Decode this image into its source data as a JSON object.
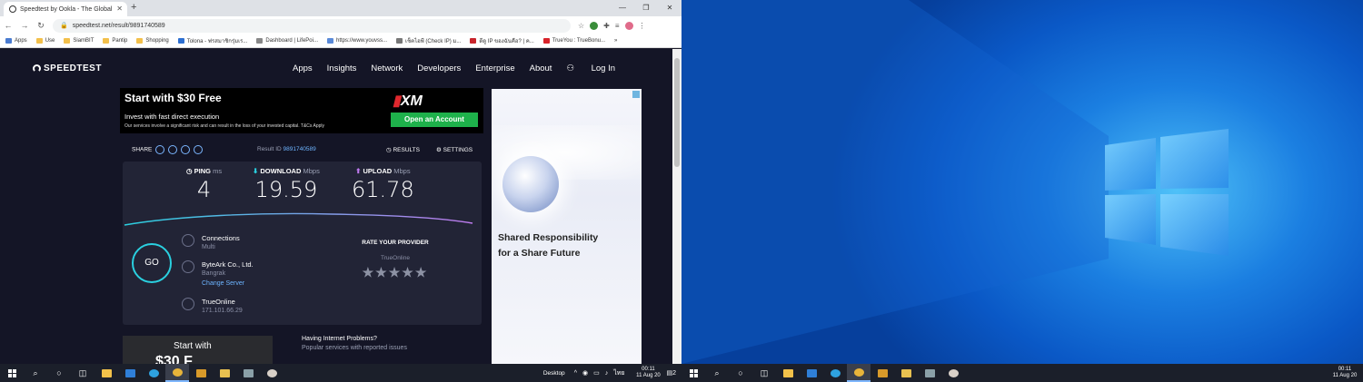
{
  "browser": {
    "tab_title": "Speedtest by Ookla - The Global",
    "tab_close": "✕",
    "new_tab": "+",
    "win_min": "—",
    "win_restore": "❐",
    "win_close": "✕",
    "url": "speedtest.net/result/9891740589",
    "bookmarks": [
      {
        "label": "Apps"
      },
      {
        "label": "Use"
      },
      {
        "label": "SiamBIT"
      },
      {
        "label": "Pantip"
      },
      {
        "label": "Shopping"
      },
      {
        "label": "Tolona - ฟรสมาชิกรุ่มเร..."
      },
      {
        "label": "Dashboard | LifePoi..."
      },
      {
        "label": "https://www.youvss..."
      },
      {
        "label": "เช็คไอพี (Check IP) ม..."
      },
      {
        "label": "ดีดู IP ของฉันคือ? | ค..."
      },
      {
        "label": "TrueYou : TrueBonu..."
      }
    ],
    "more": "»"
  },
  "site": {
    "logo": "SPEEDTEST",
    "nav": [
      "Apps",
      "Insights",
      "Network",
      "Developers",
      "Enterprise",
      "About"
    ],
    "login": "Log In"
  },
  "ad_top": {
    "headline": "Start with $30 Free",
    "sub": "Invest with fast direct execution",
    "fine": "Our services involve a significant risk and can result in the loss of your invested capital. T&Cs Apply",
    "brand": "XM",
    "cta": "Open an Account"
  },
  "share": {
    "label": "SHARE",
    "result_label": "Result ID",
    "result_id": "9891740589",
    "results_btn": "RESULTS",
    "settings_btn": "SETTINGS"
  },
  "metrics": {
    "ping": {
      "label": "PING",
      "unit": "ms",
      "value": "4"
    },
    "download": {
      "label": "DOWNLOAD",
      "unit": "Mbps",
      "value": "19.59"
    },
    "upload": {
      "label": "UPLOAD",
      "unit": "Mbps",
      "value": "61.78"
    }
  },
  "server": {
    "go": "GO",
    "connections_label": "Connections",
    "connections_value": "Multi",
    "host": "ByteArk Co., Ltd.",
    "location": "Bangrak",
    "change": "Change Server",
    "isp": "TrueOnline",
    "ip": "171.101.66.29"
  },
  "rate": {
    "title": "RATE YOUR PROVIDER",
    "isp": "TrueOnline",
    "stars": "★★★★★"
  },
  "ad_bottom": {
    "headline": "Start with",
    "big": "$30 F"
  },
  "help": {
    "title": "Having Internet Problems?",
    "sub": "Popular services with reported issues"
  },
  "ad_side": {
    "line1": "Shared Responsibility",
    "line2": "for a Share Future"
  },
  "taskbar_left": {
    "desktop": "Desktop",
    "lang": "ไทย",
    "time": "00:11",
    "date": "11 Aug 20",
    "notif": "2"
  },
  "taskbar_right": {
    "time": "00:11",
    "date": "11 Aug 20"
  },
  "icons": {
    "search": "⌕",
    "task_view": "◫",
    "store": "▣",
    "mail": "✉",
    "edge": "e",
    "chrome": "◉",
    "media": "▶",
    "folder": "▬",
    "kb": "▤",
    "app": "◍"
  }
}
